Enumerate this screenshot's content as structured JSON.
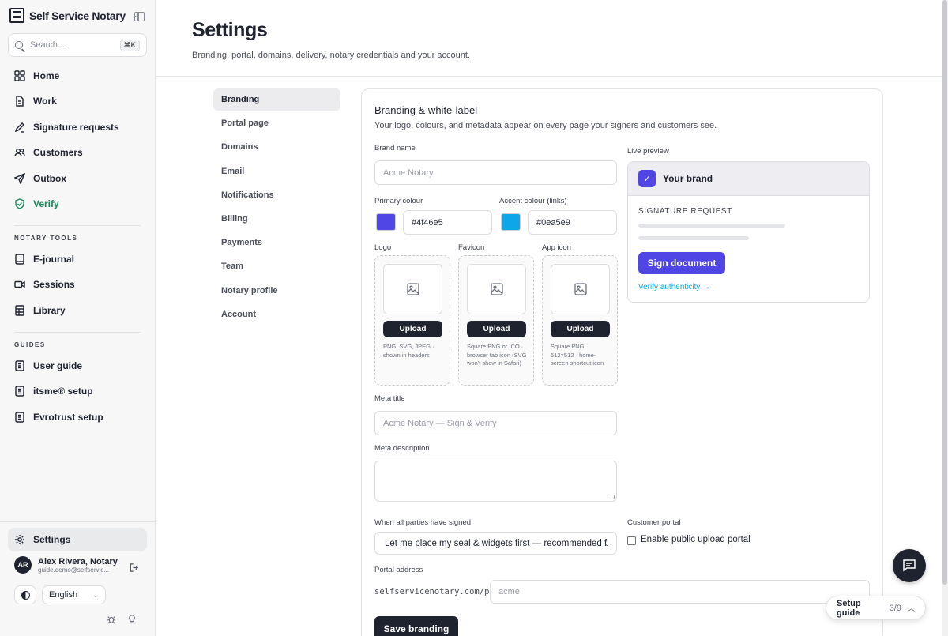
{
  "app": {
    "name": "Self Service Notary"
  },
  "search": {
    "placeholder": "Search...",
    "shortcut": "⌘K"
  },
  "nav": {
    "main": [
      {
        "label": "Home",
        "icon": "grid-icon"
      },
      {
        "label": "Work",
        "icon": "document-icon"
      },
      {
        "label": "Signature requests",
        "icon": "pen-icon"
      },
      {
        "label": "Customers",
        "icon": "users-icon"
      },
      {
        "label": "Outbox",
        "icon": "send-icon"
      },
      {
        "label": "Verify",
        "icon": "shield-check-icon"
      }
    ],
    "tools_label": "NOTARY TOOLS",
    "tools": [
      {
        "label": "E-journal",
        "icon": "book-icon"
      },
      {
        "label": "Sessions",
        "icon": "video-icon"
      },
      {
        "label": "Library",
        "icon": "library-icon"
      }
    ],
    "guides_label": "GUIDES",
    "guides": [
      {
        "label": "User guide",
        "icon": "guide-icon"
      },
      {
        "label": "itsme® setup",
        "icon": "guide-icon"
      },
      {
        "label": "Evrotrust setup",
        "icon": "guide-icon"
      }
    ],
    "settings": {
      "label": "Settings",
      "icon": "gear-icon"
    }
  },
  "user": {
    "initials": "AR",
    "name": "Alex Rivera, Notary",
    "email": "guide.demo@selfservic..."
  },
  "language": {
    "value": "English"
  },
  "page": {
    "title": "Settings",
    "subtitle": "Branding, portal, domains, delivery, notary credentials and your account."
  },
  "subnav": [
    "Branding",
    "Portal page",
    "Domains",
    "Email",
    "Notifications",
    "Billing",
    "Payments",
    "Team",
    "Notary profile",
    "Account"
  ],
  "branding": {
    "title": "Branding & white-label",
    "subtitle": "Your logo, colours, and metadata appear on every page your signers and customers see.",
    "brand_name_label": "Brand name",
    "brand_name_placeholder": "Acme Notary",
    "primary_label": "Primary colour",
    "primary_value": "#4f46e5",
    "accent_label": "Accent colour (links)",
    "accent_value": "#0ea5e9",
    "uploads": [
      {
        "label": "Logo",
        "button": "Upload",
        "hint": "PNG, SVG, JPEG · shown in headers"
      },
      {
        "label": "Favicon",
        "button": "Upload",
        "hint": "Square PNG or ICO · browser tab icon (SVG won't show in Safari)"
      },
      {
        "label": "App icon",
        "button": "Upload",
        "hint": "Square PNG, 512×512 · home-screen shortcut icon"
      }
    ],
    "meta_title_label": "Meta title",
    "meta_title_placeholder": "Acme Notary — Sign & Verify",
    "meta_desc_label": "Meta description",
    "signed_label": "When all parties have signed",
    "signed_value": "Let me place my seal & widgets first — recommended f",
    "portal_label": "Customer portal",
    "portal_checkbox": "Enable public upload portal",
    "address_label": "Portal address",
    "address_prefix": "selfservicenotary.com/p/",
    "address_placeholder": "acme",
    "save": "Save branding"
  },
  "preview": {
    "label": "Live preview",
    "brand": "Your brand",
    "doc_label": "SIGNATURE REQUEST",
    "button": "Sign document",
    "link": "Verify authenticity →"
  },
  "setup": {
    "label": "Setup guide",
    "progress": "3/9"
  },
  "colors": {
    "primary": "#4f46e5",
    "accent": "#0ea5e9",
    "verify": "#168a5b",
    "dark": "#1f2330"
  }
}
